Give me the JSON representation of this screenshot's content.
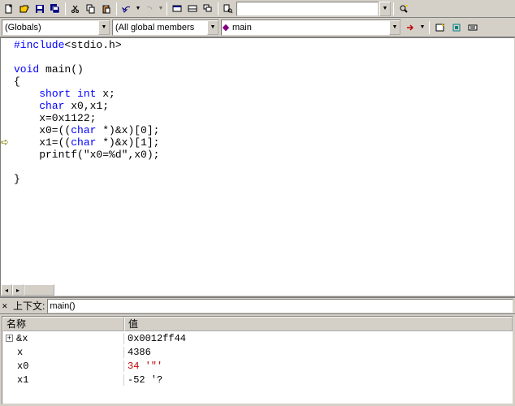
{
  "toolbar1": {
    "find_input": ""
  },
  "toolbar2": {
    "scope": "(Globals)",
    "members": "(All global members",
    "func": "main"
  },
  "code": {
    "lines": [
      {
        "pre": "",
        "parts": [
          {
            "t": "#include",
            "c": "pp"
          },
          {
            "t": "<stdio.h>",
            "c": "hdr"
          }
        ]
      },
      {
        "pre": "",
        "parts": []
      },
      {
        "pre": "",
        "parts": [
          {
            "t": "void",
            "c": "kw"
          },
          {
            "t": " main()",
            "c": ""
          }
        ]
      },
      {
        "pre": "",
        "parts": [
          {
            "t": "{",
            "c": ""
          }
        ]
      },
      {
        "pre": "    ",
        "parts": [
          {
            "t": "short",
            "c": "kw"
          },
          {
            "t": " ",
            "c": ""
          },
          {
            "t": "int",
            "c": "kw"
          },
          {
            "t": " x;",
            "c": ""
          }
        ]
      },
      {
        "pre": "    ",
        "parts": [
          {
            "t": "char",
            "c": "kw"
          },
          {
            "t": " x0,x1;",
            "c": ""
          }
        ]
      },
      {
        "pre": "    ",
        "parts": [
          {
            "t": "x=0x1122;",
            "c": ""
          }
        ]
      },
      {
        "pre": "    ",
        "parts": [
          {
            "t": "x0=((",
            "c": ""
          },
          {
            "t": "char",
            "c": "kw"
          },
          {
            "t": " *)&x)[0];",
            "c": ""
          }
        ]
      },
      {
        "pre": "    ",
        "parts": [
          {
            "t": "x1=((",
            "c": ""
          },
          {
            "t": "char",
            "c": "kw"
          },
          {
            "t": " *)&x)[1];",
            "c": ""
          }
        ]
      },
      {
        "pre": "    ",
        "parts": [
          {
            "t": "printf(",
            "c": ""
          },
          {
            "t": "\"x0=%d\"",
            "c": "str"
          },
          {
            "t": ",x0);",
            "c": ""
          }
        ]
      },
      {
        "pre": "",
        "parts": []
      },
      {
        "pre": "",
        "parts": [
          {
            "t": "}",
            "c": ""
          }
        ]
      }
    ],
    "current_line": 8
  },
  "watch": {
    "context_label": "上下文:",
    "context_value": "main()",
    "col_name": "名称",
    "col_value": "值",
    "rows": [
      {
        "expand": "+",
        "indent": 0,
        "name": "&x",
        "value": "0x0012ff44",
        "red": false
      },
      {
        "expand": "",
        "indent": 1,
        "name": "x",
        "value": "4386",
        "red": false
      },
      {
        "expand": "",
        "indent": 1,
        "name": "x0",
        "value": "34 '\"'",
        "red": true
      },
      {
        "expand": "",
        "indent": 1,
        "name": "x1",
        "value": "-52 '?",
        "red": false
      }
    ]
  }
}
